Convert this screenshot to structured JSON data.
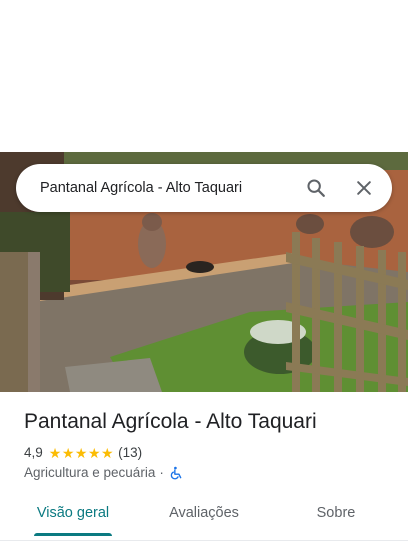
{
  "search": {
    "query": "Pantanal Agrícola - Alto Taquari",
    "search_icon": "search-icon",
    "close_icon": "close-icon"
  },
  "photo": {
    "subject": "place-photo"
  },
  "place": {
    "name": "Pantanal Agrícola - Alto Taquari",
    "rating": "4,9",
    "stars_filled": 5,
    "review_count": "(13)",
    "category": "Agricultura e pecuária",
    "separator": "·",
    "accessibility_icon": "wheelchair-icon"
  },
  "tabs": [
    {
      "label": "Visão geral",
      "active": true
    },
    {
      "label": "Avaliações",
      "active": false
    },
    {
      "label": "Sobre",
      "active": false
    }
  ],
  "colors": {
    "accent": "#0b7a81",
    "star": "#fbbc04",
    "accessibility": "#1a73e8"
  }
}
